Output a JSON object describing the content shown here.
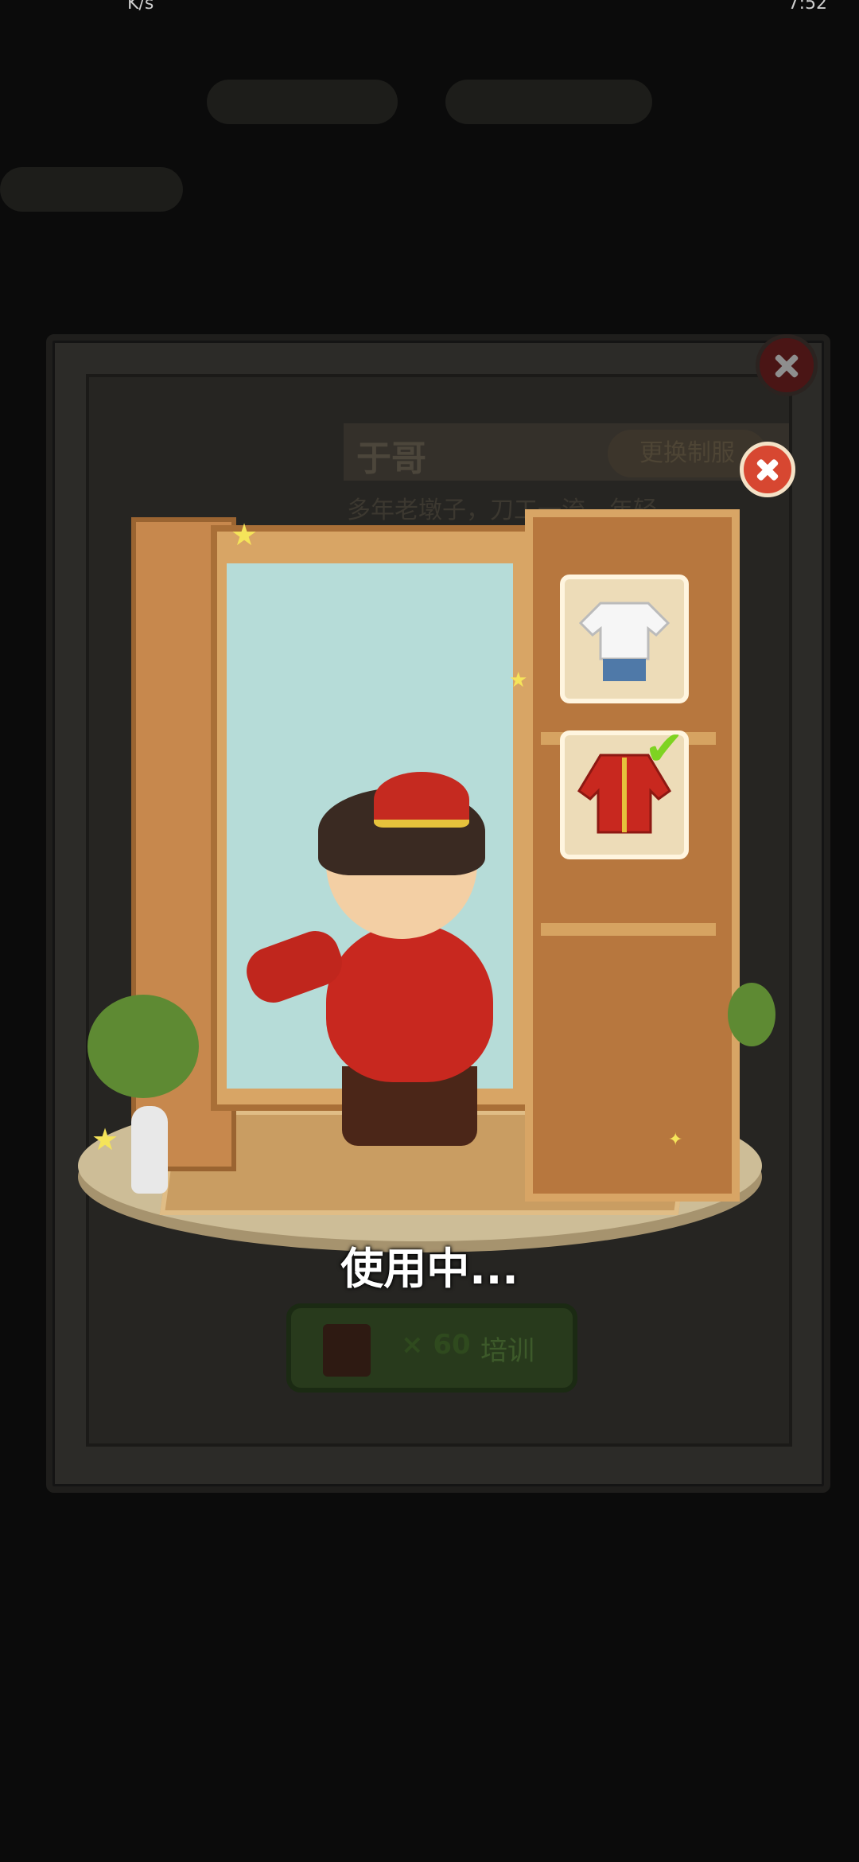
{
  "status_bar": {
    "left": "K/s",
    "right": "7:52"
  },
  "card": {
    "character_name": "于哥",
    "change_uniform_label": "更换制服",
    "description": "多年老墩子，刀工一流…年轻"
  },
  "wardrobe": {
    "status_text": "使用中...",
    "selected_outfit": "red-tang-suit",
    "outfits": [
      {
        "name": "white-shirt-outfit"
      },
      {
        "name": "red-tang-suit-outfit"
      }
    ]
  },
  "train_button": {
    "cost": "× 60",
    "label": "培训"
  },
  "colors": {
    "accent_red": "#d74731",
    "button_green": "#2e4a1e",
    "mirror": "#b6dcd8",
    "wood": "#d8a565"
  }
}
